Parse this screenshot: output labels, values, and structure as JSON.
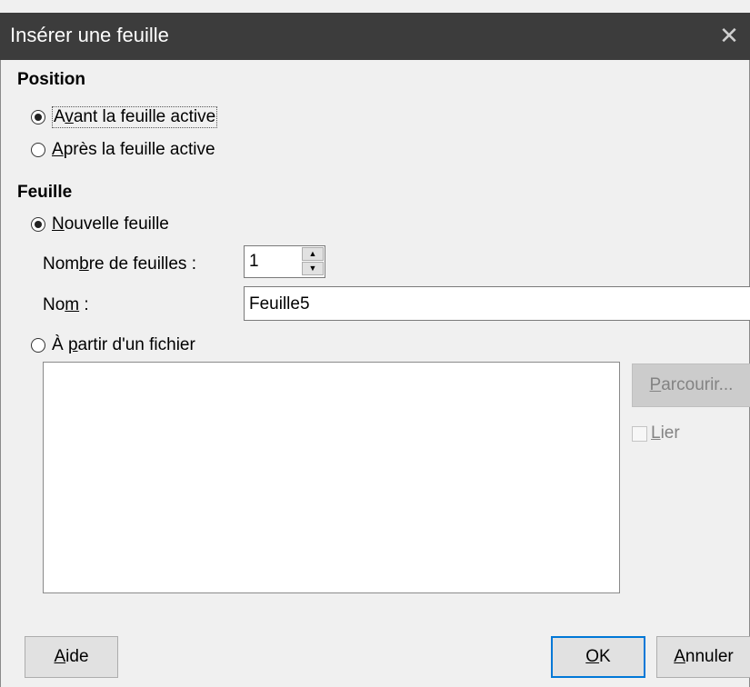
{
  "dialog": {
    "title": "Insérer une feuille",
    "close_glyph": "✕"
  },
  "position_section": {
    "heading": "Position",
    "before_label": {
      "mnemonic_pre": "A",
      "mnemonic": "v",
      "rest": "ant la feuille active"
    },
    "after_label": {
      "mnemonic_pre": "",
      "mnemonic": "A",
      "rest": "près la feuille active"
    },
    "selected": "before"
  },
  "sheet_section": {
    "heading": "Feuille",
    "new_sheet_label": {
      "mnemonic_pre": "",
      "mnemonic": "N",
      "rest": "ouvelle feuille"
    },
    "count_label": {
      "mnemonic_pre": "Nom",
      "mnemonic": "b",
      "rest": "re de feuilles :"
    },
    "count_value": "1",
    "name_label": {
      "mnemonic_pre": "No",
      "mnemonic": "m",
      "rest": " :"
    },
    "name_value": "Feuille5",
    "from_file_label": {
      "mnemonic_pre": "À ",
      "mnemonic": "p",
      "rest": "artir d'un fichier"
    },
    "selected": "new_sheet"
  },
  "file_panel": {
    "browse_label": {
      "mnemonic_pre": "",
      "mnemonic": "P",
      "rest": "arcourir..."
    },
    "link_label": {
      "mnemonic_pre": "",
      "mnemonic": "L",
      "rest": "ier"
    },
    "link_checked": false
  },
  "footer": {
    "help_label": {
      "mnemonic_pre": "",
      "mnemonic": "A",
      "rest": "ide"
    },
    "ok_label": {
      "mnemonic_pre": "",
      "mnemonic": "O",
      "rest": "K"
    },
    "cancel_label": {
      "mnemonic_pre": "",
      "mnemonic": "A",
      "rest": "nnuler"
    }
  },
  "icons": {
    "spin_up": "▲",
    "spin_down": "▼"
  },
  "colors": {
    "titlebar": "#3c3c3c",
    "dialog_bg": "#f0f0f0",
    "accent": "#0078d7",
    "disabled_text": "#838383"
  }
}
